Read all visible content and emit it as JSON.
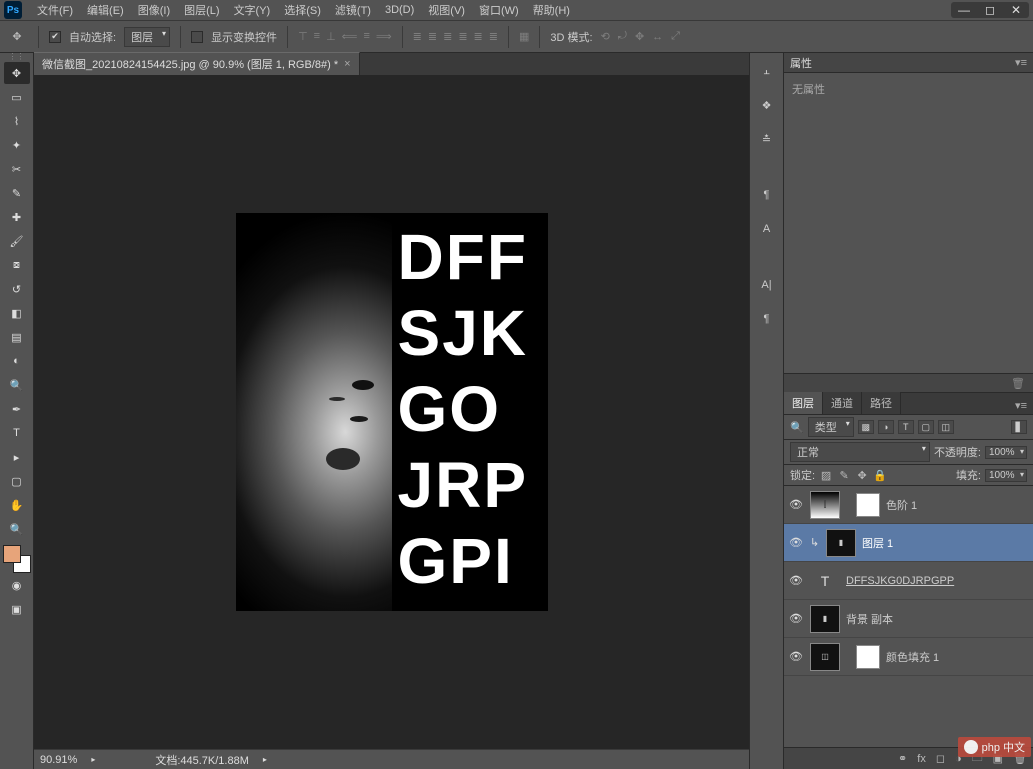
{
  "app": {
    "logo": "Ps"
  },
  "menu": {
    "file": "文件(F)",
    "edit": "编辑(E)",
    "image": "图像(I)",
    "layer": "图层(L)",
    "type": "文字(Y)",
    "select": "选择(S)",
    "filter": "滤镜(T)",
    "3d": "3D(D)",
    "view": "视图(V)",
    "window": "窗口(W)",
    "help": "帮助(H)"
  },
  "options": {
    "auto_select_label": "自动选择:",
    "auto_select_value": "图层",
    "show_transform": "显示变换控件",
    "mode3d": "3D 模式:"
  },
  "doc": {
    "tab_title": "微信截图_20210824154425.jpg @ 90.9% (图层 1, RGB/8#) *",
    "text_overlay": "DFF\nSJK\nGO\nJRP\nGPI"
  },
  "status": {
    "zoom": "90.91%",
    "docinfo": "文档:445.7K/1.88M"
  },
  "props": {
    "tab": "属性",
    "empty": "无属性"
  },
  "layers_panel": {
    "tabs": {
      "layers": "图层",
      "channels": "通道",
      "paths": "路径"
    },
    "filter_prefix": "🔍",
    "filter_kind": "类型",
    "blend_mode": "正常",
    "opacity_label": "不透明度:",
    "opacity": "100%",
    "lock_label": "锁定:",
    "fill_label": "填充:",
    "fill": "100%",
    "layers": [
      {
        "name": "色阶 1",
        "type": "adj"
      },
      {
        "name": "图层 1",
        "type": "img",
        "selected": true,
        "clip": true
      },
      {
        "name": "DFFSJKG0DJRPGPP",
        "type": "text"
      },
      {
        "name": "背景 副本",
        "type": "img2"
      },
      {
        "name": "颜色填充 1",
        "type": "fill"
      }
    ]
  },
  "watermark": "php 中文"
}
